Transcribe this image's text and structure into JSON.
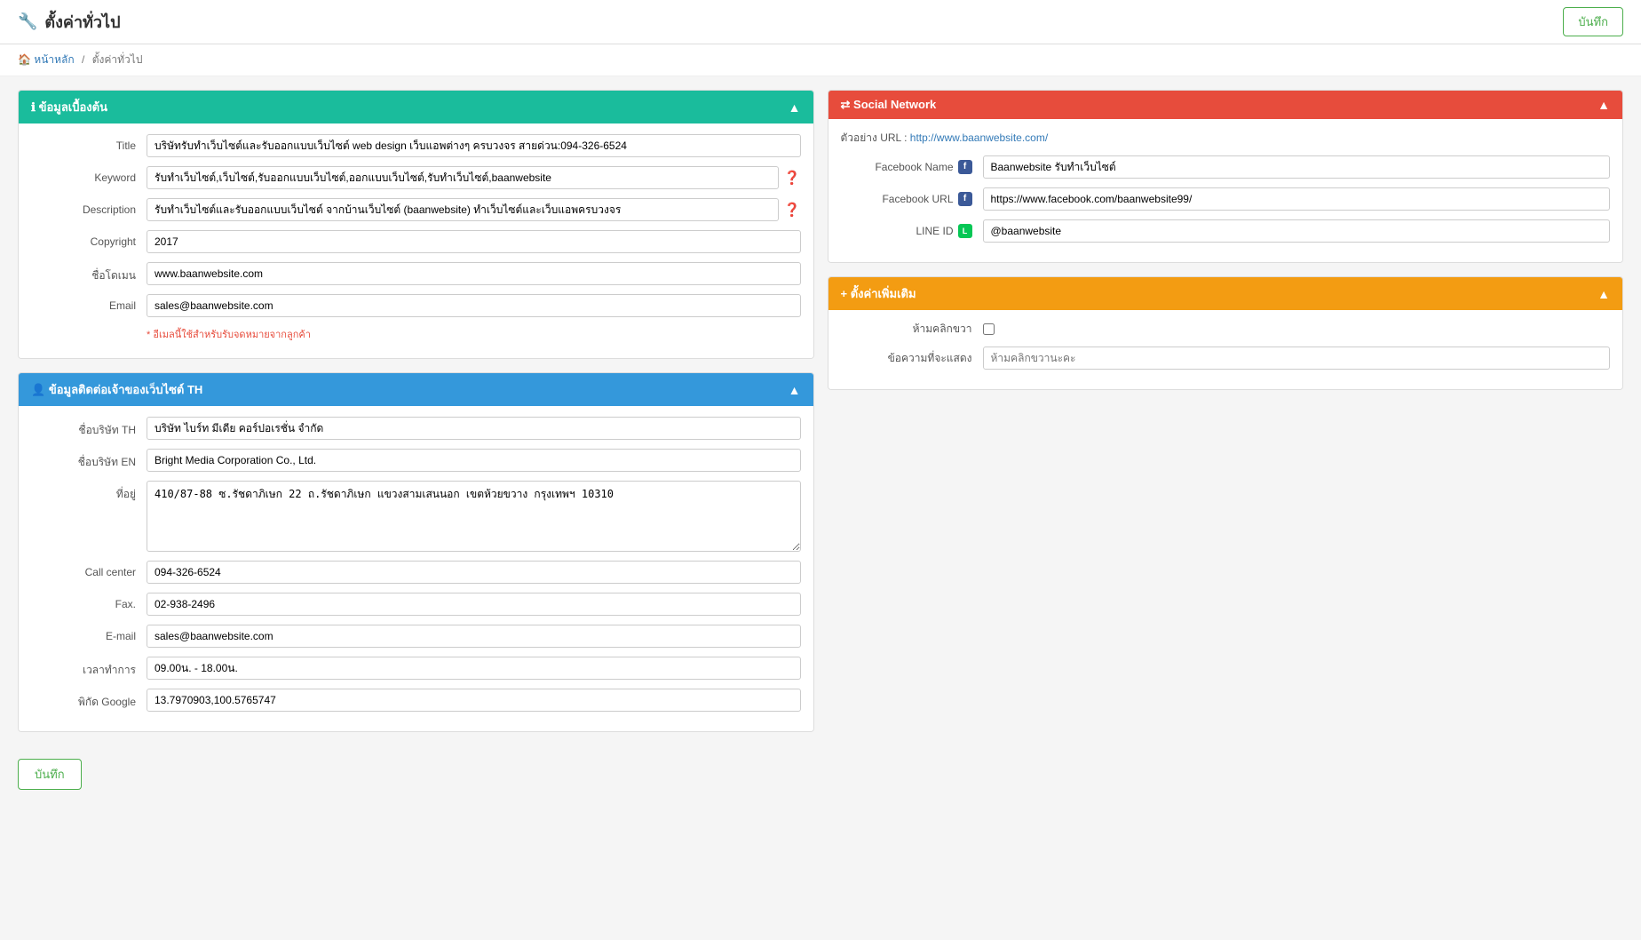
{
  "topbar": {
    "title": "ตั้งค่าทั่วไป",
    "save_label": "บันทึก",
    "gear_icon": "🔧"
  },
  "breadcrumb": {
    "home_label": "หน้าหลัก",
    "current_label": "ตั้งค่าทั่วไป"
  },
  "panel_basic": {
    "header": "ข้อมูลเบื้องต้น",
    "toggle": "▲",
    "fields": {
      "title_label": "Title",
      "title_value": "บริษัทรับทำเว็บไซต์และรับออกแบบเว็บไซต์ web design เว็บแอพต่างๆ ครบวงจร สายด่วน:094-326-6524",
      "keyword_label": "Keyword",
      "keyword_value": "รับทำเว็บไซต์,เว็บไซต์,รับออกแบบเว็บไซต์,ออกแบบเว็บไซต์,รับทำเว็บไซต์,baanwebsite",
      "description_label": "Description",
      "description_value": "รับทำเว็บไซต์และรับออกแบบเว็บไซต์ จากบ้านเว็บไซต์ (baanwebsite) ทำเว็บไซต์และเว็บแอพครบวงจร",
      "copyright_label": "Copyright",
      "copyright_value": "2017",
      "domain_label": "ชื่อโดเมน",
      "domain_value": "www.baanwebsite.com",
      "email_label": "Email",
      "email_value": "sales@baanwebsite.com",
      "email_hint": "* อีเมลนี้ใช้สำหรับรับจดหมายจากลูกค้า"
    }
  },
  "panel_contact": {
    "header": "ข้อมูลติดต่อเจ้าของเว็บไซต์ TH",
    "toggle": "▲",
    "fields": {
      "company_th_label": "ชื่อบริษัท TH",
      "company_th_value": "บริษัท ไบร์ท มีเดีย คอร์ปอเรชั่น จำกัด",
      "company_en_label": "ชื่อบริษัท EN",
      "company_en_value": "Bright Media Corporation Co., Ltd.",
      "address_label": "ที่อยู่",
      "address_value": "410/87-88 ซ.รัชดาภิเษก 22 ถ.รัชดาภิเษก แขวงสามเสนนอก เขตห้วยขวาง กรุงเทพฯ 10310",
      "callcenter_label": "Call center",
      "callcenter_value": "094-326-6524",
      "fax_label": "Fax.",
      "fax_value": "02-938-2496",
      "email_label": "E-mail",
      "email_value": "sales@baanwebsite.com",
      "worktime_label": "เวลาทำการ",
      "worktime_value": "09.00น. - 18.00น.",
      "google_label": "พิกัด Google",
      "google_value": "13.7970903,100.5765747"
    }
  },
  "panel_social": {
    "header": "Social Network",
    "toggle": "▲",
    "example_url_label": "ตัวอย่าง URL : ",
    "example_url": "http://www.baanwebsite.com/",
    "fb_name_label": "Facebook Name",
    "fb_name_value": "Baanwebsite รับทำเว็บไซต์",
    "fb_url_label": "Facebook URL",
    "fb_url_value": "https://www.facebook.com/baanwebsite99/",
    "line_id_label": "LINE ID",
    "line_id_value": "@baanwebsite"
  },
  "panel_extra": {
    "header": "+ ตั้งค่าเพิ่มเติม",
    "toggle": "▲",
    "right_click_label": "ห้ามคลิกขวา",
    "message_label": "ข้อความที่จะแสดง",
    "message_placeholder": "ห้ามคลิกขวานะคะ"
  },
  "footer": {
    "save_label": "บันทึก"
  }
}
